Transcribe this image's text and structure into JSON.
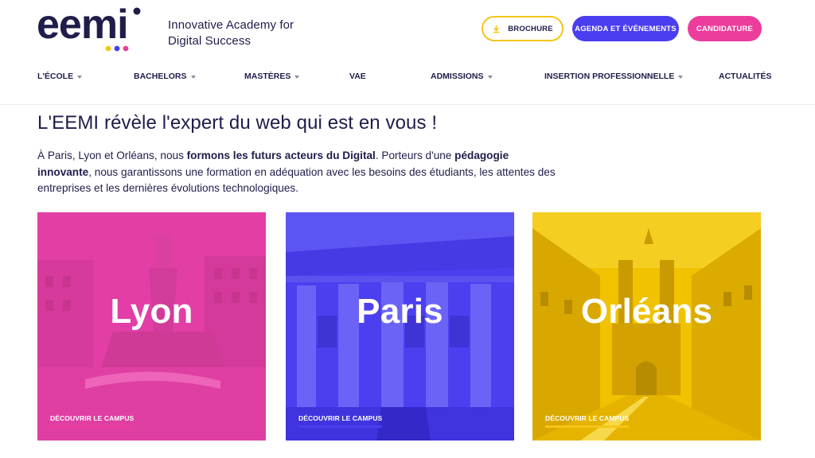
{
  "header": {
    "logo_text": "eemi",
    "tagline_line1": "Innovative Academy for",
    "tagline_line2": "Digital Success",
    "buttons": {
      "brochure": "BROCHURE",
      "agenda": "AGENDA ET ÉVÉNEMENTS",
      "candidature": "CANDIDATURE"
    }
  },
  "nav": [
    {
      "label": "L'ÉCOLE",
      "has_dropdown": true
    },
    {
      "label": "BACHELORS",
      "has_dropdown": true
    },
    {
      "label": "MASTÈRES",
      "has_dropdown": true
    },
    {
      "label": "VAE",
      "has_dropdown": false
    },
    {
      "label": "ADMISSIONS",
      "has_dropdown": true
    },
    {
      "label": "INSERTION PROFESSIONNELLE",
      "has_dropdown": true
    },
    {
      "label": "ACTUALITÉS",
      "has_dropdown": false
    }
  ],
  "main": {
    "headline": "L'EEMI révèle l'expert du web qui est en vous !",
    "intro": {
      "p1": "À Paris, Lyon et Orléans, nous ",
      "b1": "formons les futurs acteurs du Digital",
      "p2": ". Porteurs d'une ",
      "b2": "pédagogie innovante",
      "p3": ", nous garantissons une formation en adéquation avec les besoins des étudiants, les attentes des entreprises et les dernières évolutions technologiques."
    }
  },
  "campus_cards": [
    {
      "city": "Lyon",
      "cta": "DÉCOUVRIR LE CAMPUS",
      "color": "#e63fa8"
    },
    {
      "city": "Paris",
      "cta": "DÉCOUVRIR LE CAMPUS",
      "color": "#4a3ef0"
    },
    {
      "city": "Orléans",
      "cta": "DÉCOUVRIR LE CAMPUS",
      "color": "#f2c400"
    }
  ],
  "colors": {
    "navy": "#1f1d4a",
    "yellow": "#f5c518",
    "blue": "#4a3ef0",
    "pink": "#ec3d9c"
  },
  "icons": {
    "brochure": "download-icon",
    "nav_dropdown": "chevron-down-icon"
  }
}
